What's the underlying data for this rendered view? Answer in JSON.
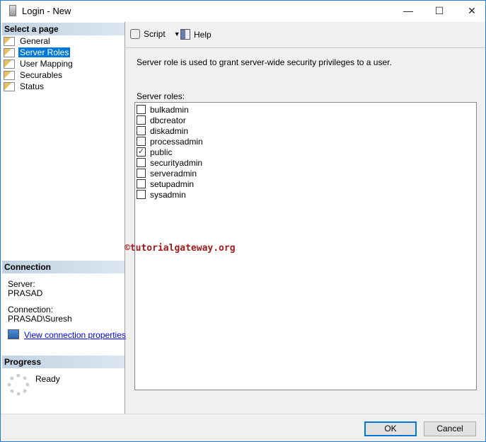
{
  "window": {
    "title": "Login - New",
    "minimize": "—",
    "maximize": "☐",
    "close": "✕"
  },
  "sidebar": {
    "header": "Select a page",
    "items": [
      {
        "label": "General"
      },
      {
        "label": "Server Roles"
      },
      {
        "label": "User Mapping"
      },
      {
        "label": "Securables"
      },
      {
        "label": "Status"
      }
    ],
    "connection": {
      "header": "Connection",
      "server_label": "Server:",
      "server": "PRASAD",
      "connection_label": "Connection:",
      "connection": "PRASAD\\Suresh",
      "view_link": "View connection properties"
    },
    "progress": {
      "header": "Progress",
      "status": "Ready"
    }
  },
  "toolbar": {
    "script": "Script",
    "help": "Help"
  },
  "main": {
    "description": "Server role is used to grant server-wide security privileges to a user.",
    "roles_label": "Server roles:",
    "roles": [
      {
        "name": "bulkadmin",
        "checked": false
      },
      {
        "name": "dbcreator",
        "checked": false
      },
      {
        "name": "diskadmin",
        "checked": false
      },
      {
        "name": "processadmin",
        "checked": false
      },
      {
        "name": "public",
        "checked": true
      },
      {
        "name": "securityadmin",
        "checked": false
      },
      {
        "name": "serveradmin",
        "checked": false
      },
      {
        "name": "setupadmin",
        "checked": false
      },
      {
        "name": "sysadmin",
        "checked": false
      }
    ]
  },
  "watermark": "©tutorialgateway.org",
  "footer": {
    "ok": "OK",
    "cancel": "Cancel"
  }
}
